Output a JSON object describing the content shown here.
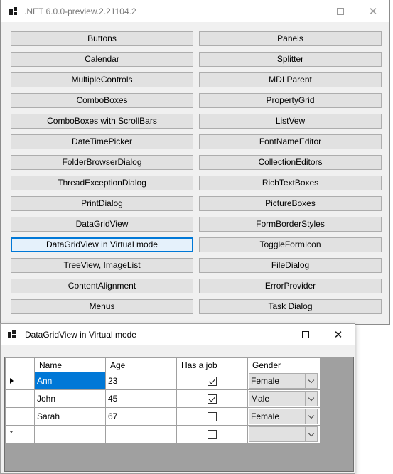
{
  "main_window": {
    "title": ".NET 6.0.0-preview.2.21104.2",
    "buttons_left": [
      "Buttons",
      "Calendar",
      "MultipleControls",
      "ComboBoxes",
      "ComboBoxes with ScrollBars",
      "DateTimePicker",
      "FolderBrowserDialog",
      "ThreadExceptionDialog",
      "PrintDialog",
      "DataGridView",
      "DataGridView in Virtual mode",
      "TreeView, ImageList",
      "ContentAlignment",
      "Menus"
    ],
    "buttons_right": [
      "Panels",
      "Splitter",
      "MDI Parent",
      "PropertyGrid",
      "ListVew",
      "FontNameEditor",
      "CollectionEditors",
      "RichTextBoxes",
      "PictureBoxes",
      "FormBorderStyles",
      "ToggleFormIcon",
      "FileDialog",
      "ErrorProvider",
      "Task Dialog"
    ]
  },
  "child_window": {
    "title": "DataGridView in Virtual mode",
    "columns": [
      "Name",
      "Age",
      "Has a job",
      "Gender"
    ],
    "rows": [
      {
        "name": "Ann",
        "age": "23",
        "has_job": true,
        "gender": "Female"
      },
      {
        "name": "John",
        "age": "45",
        "has_job": true,
        "gender": "Male"
      },
      {
        "name": "Sarah",
        "age": "67",
        "has_job": false,
        "gender": "Female"
      }
    ],
    "new_row_marker": "*"
  },
  "colors": {
    "accent": "#0078d7",
    "grid_background": "#a0a0a0",
    "window_background": "#f0f0f0"
  }
}
